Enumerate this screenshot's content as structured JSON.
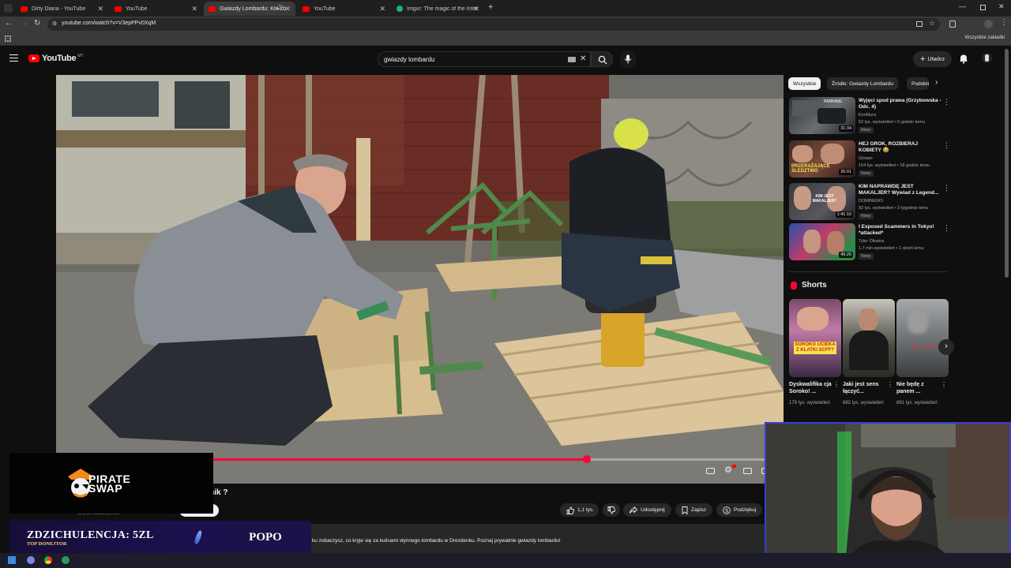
{
  "browser": {
    "tabs": [
      {
        "title": "Dirty Diana - YouTube",
        "icon": "youtube-icon"
      },
      {
        "title": "YouTube",
        "icon": "youtube-icon"
      },
      {
        "title": "Gwiazdy Lombardu: Kto zb",
        "icon": "youtube-icon"
      },
      {
        "title": "YouTube",
        "icon": "youtube-icon"
      },
      {
        "title": "Imgur: The magic of the Intern",
        "icon": "imgur-icon"
      }
    ],
    "new_tab": "+",
    "url": "youtube.com/watch?v=V3epPPv0XqM",
    "bookmarks_all": "Wszystkie zakładki"
  },
  "youtube": {
    "logo_word": "YouTube",
    "logo_country": "MT",
    "search_value": "gwiazdy lombardu",
    "create_label": "Utwórz"
  },
  "player": {
    "progress": 0.73
  },
  "video_info": {
    "title_fragment": "nnik ?",
    "subscribers": "30,3 tys. subskrybentów",
    "like_count": "1,1 tys.",
    "share_label": "Udostępnij",
    "save_label": "Zapisz",
    "thanks_label": "Podziękuj",
    "description": "ku zobaczysz, co kryje się za kulisami słynnego lombardu w Drezdenku. Poznaj prywatnie gwiazdy lombardu!"
  },
  "sidebar": {
    "chips": [
      "Wszystkie",
      "Źródło: Gwiazdy Lombardu",
      "Podobn"
    ],
    "recommendations": [
      {
        "title": "Wyjęci spod prawa (Grzybowska - Odc. 4)",
        "channel": "Konfitura",
        "meta": "62 tys. wyświetleń • 6 godzin temu",
        "badge": "Nowy",
        "duration": "31:34",
        "thumb_text": "PARKING"
      },
      {
        "title": "HEJ GROK, ROZBIERAJ KOBIETY 😂",
        "channel": "Gimper",
        "meta": "154 tys. wyświetleń • 18 godzin temu",
        "badge": "Nowy",
        "duration": "26:01",
        "thumb_text": "PRZERAŻAJĄCE ŚLEDZTWO"
      },
      {
        "title": "KIM NAPRAWDĘ JEST MAKALJER? Wywiad z Legend...",
        "channel": "DOMINEWS",
        "meta": "92 tys. wyświetleń • 2 tygodnie temu",
        "badge": "Nowy",
        "duration": "1:41:10",
        "thumb_text": "KIM JEST MAKALJER?"
      },
      {
        "title": "I Exposed Scammers in Tokyo! *attacked*",
        "channel": "Tyler Oliveira",
        "meta": "1,7 mln wyświetleń • 1 dzień temu",
        "badge": "Nowy",
        "duration": "45:26",
        "thumb_text": ""
      }
    ],
    "shorts_title": "Shorts",
    "shorts": [
      {
        "title": "Dyskwalifika cja Soroko! ...",
        "views": "179 tys. wyświetleń",
        "thumb_text": "SOROKO UCIEKA Z KLATKI SCFF?"
      },
      {
        "title": "Jaki jest sens łączyć...",
        "views": "682 tys. wyświetleń",
        "thumb_text": ""
      },
      {
        "title": "Nie będę z panem ...",
        "views": "891 tys. wyświetleń",
        "thumb_text": "Wyj... ci na le..."
      }
    ]
  },
  "overlays": {
    "sponsor_line1": "PIRATE",
    "sponsor_line2": "SWAP",
    "donation_main": "ZDZICHULENCJA: 5ZL",
    "donation_sub": "TOP DONEJTOR",
    "donation_name": "POPO"
  }
}
